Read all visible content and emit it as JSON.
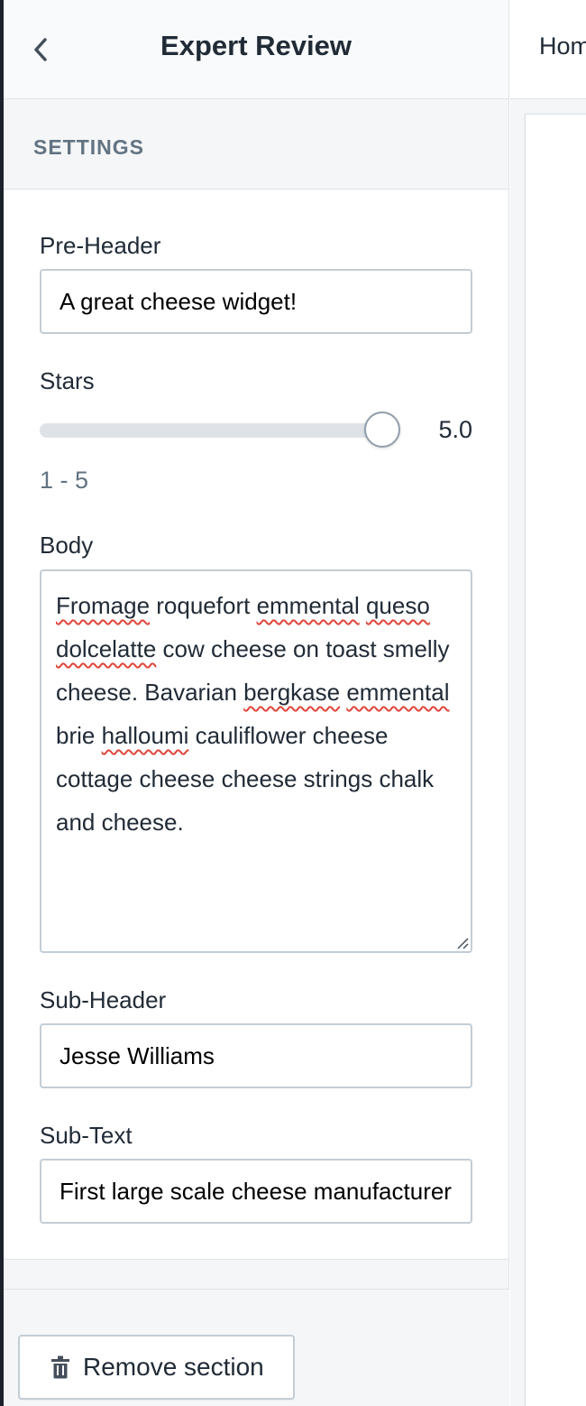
{
  "header": {
    "title": "Expert Review",
    "back_icon": "chevron-left-icon"
  },
  "settings": {
    "label": "SETTINGS"
  },
  "fields": {
    "pre_header": {
      "label": "Pre-Header",
      "value": "A great cheese widget!"
    },
    "stars": {
      "label": "Stars",
      "value": 5.0,
      "value_text": "5.0",
      "min": 1,
      "max": 5,
      "range_text": "1 - 5"
    },
    "body": {
      "label": "Body",
      "value_parts": [
        {
          "text": "Fromage",
          "spell": true
        },
        {
          "text": " roquefort ",
          "spell": false
        },
        {
          "text": "emmental",
          "spell": true
        },
        {
          "text": " ",
          "spell": false
        },
        {
          "text": "queso",
          "spell": true
        },
        {
          "text": " ",
          "spell": false
        },
        {
          "text": "dolcelatte",
          "spell": true
        },
        {
          "text": " cow cheese on toast smelly cheese. Bavarian ",
          "spell": false
        },
        {
          "text": "bergkase",
          "spell": true
        },
        {
          "text": " ",
          "spell": false
        },
        {
          "text": "emmental",
          "spell": true
        },
        {
          "text": " brie ",
          "spell": false
        },
        {
          "text": "halloumi",
          "spell": true
        },
        {
          "text": " cauliflower cheese cottage cheese cheese strings chalk and cheese.",
          "spell": false
        }
      ]
    },
    "sub_header": {
      "label": "Sub-Header",
      "value": "Jesse Williams"
    },
    "sub_text": {
      "label": "Sub-Text",
      "value": "First large scale cheese manufacturer"
    }
  },
  "footer": {
    "remove_label": "Remove section",
    "remove_icon": "trash-icon"
  },
  "main": {
    "topbar_text": "Hom"
  },
  "colors": {
    "border": "#c4cdd5",
    "subdued": "#637381",
    "spellcheck": "#e0453a"
  }
}
